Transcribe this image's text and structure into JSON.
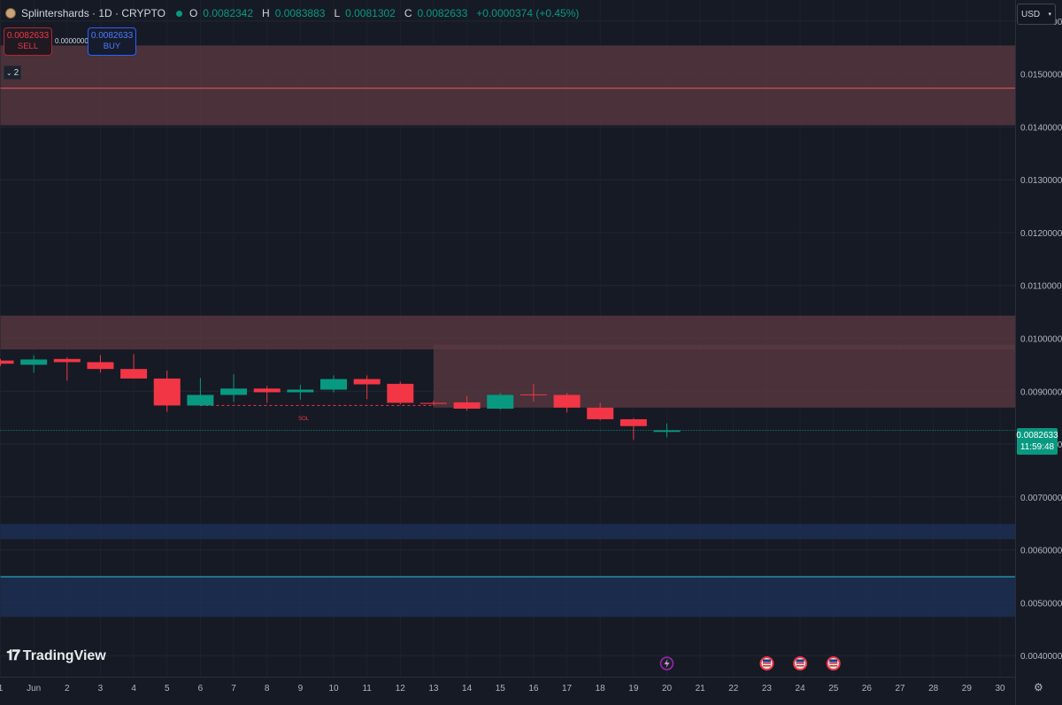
{
  "header": {
    "symbol": "Splintershards · 1D · CRYPTO",
    "open_label": "O",
    "open": "0.0082342",
    "high_label": "H",
    "high": "0.0083883",
    "low_label": "L",
    "low": "0.0081302",
    "close_label": "C",
    "close": "0.0082633",
    "change": "+0.0000374 (+0.45%)"
  },
  "trade": {
    "sell_price": "0.0082633",
    "sell_label": "SELL",
    "spread": "0.0000000",
    "buy_price": "0.0082633",
    "buy_label": "BUY"
  },
  "indicators_badge": "2",
  "currency": "USD",
  "last_price": {
    "value": "0.0082633",
    "countdown": "11:59:48"
  },
  "brand": "TradingView",
  "colors": {
    "up": "#089981",
    "down": "#f23645",
    "supply_zone": "#5c3a42",
    "demand_zone": "#1e3159",
    "background": "#161a25"
  },
  "chart_data": {
    "type": "candlestick",
    "y_axis": {
      "ylim": [
        0.0036,
        0.0164
      ],
      "ticks": [
        0.016,
        0.015,
        0.014,
        0.013,
        0.012,
        0.011,
        0.01,
        0.009,
        0.008,
        0.007,
        0.006,
        0.005,
        0.004
      ],
      "tick_labels": [
        "0.0160000",
        "0.0150000",
        "0.0140000",
        "0.0130000",
        "0.0120000",
        "0.0110000",
        "0.0100000",
        "0.0090000",
        "0.0080000",
        "0.0070000",
        "0.0060000",
        "0.0050000",
        "0.0040000"
      ]
    },
    "x_axis": {
      "xlim": [
        0,
        31
      ],
      "ticks": [
        0,
        1,
        2,
        3,
        4,
        5,
        6,
        7,
        8,
        9,
        10,
        11,
        12,
        13,
        14,
        15,
        16,
        17,
        18,
        19,
        20,
        21,
        22,
        23,
        24,
        25,
        26,
        27,
        28,
        29,
        30
      ],
      "tick_labels": [
        "1",
        "Jun",
        "2",
        "3",
        "4",
        "5",
        "6",
        "7",
        "8",
        "9",
        "10",
        "11",
        "12",
        "13",
        "14",
        "15",
        "16",
        "17",
        "18",
        "19",
        "20",
        "21",
        "22",
        "23",
        "24",
        "25",
        "26",
        "27",
        "28",
        "29",
        "30"
      ]
    },
    "candles": [
      {
        "x": 0,
        "o": 0.00958,
        "h": 0.00961,
        "l": 0.00948,
        "c": 0.00952
      },
      {
        "x": 1,
        "o": 0.0095,
        "h": 0.00968,
        "l": 0.00935,
        "c": 0.0096
      },
      {
        "x": 2,
        "o": 0.00961,
        "h": 0.00964,
        "l": 0.0092,
        "c": 0.00955
      },
      {
        "x": 3,
        "o": 0.00955,
        "h": 0.00968,
        "l": 0.00935,
        "c": 0.00942
      },
      {
        "x": 4,
        "o": 0.00942,
        "h": 0.0097,
        "l": 0.00924,
        "c": 0.00924
      },
      {
        "x": 5,
        "o": 0.00924,
        "h": 0.00939,
        "l": 0.00861,
        "c": 0.00873
      },
      {
        "x": 6,
        "o": 0.00873,
        "h": 0.00925,
        "l": 0.00872,
        "c": 0.00893
      },
      {
        "x": 7,
        "o": 0.00893,
        "h": 0.00932,
        "l": 0.0088,
        "c": 0.00905
      },
      {
        "x": 8,
        "o": 0.00905,
        "h": 0.0091,
        "l": 0.00878,
        "c": 0.00898
      },
      {
        "x": 9,
        "o": 0.00898,
        "h": 0.00912,
        "l": 0.00884,
        "c": 0.00903
      },
      {
        "x": 10,
        "o": 0.00903,
        "h": 0.0093,
        "l": 0.00898,
        "c": 0.00923
      },
      {
        "x": 11,
        "o": 0.00923,
        "h": 0.0093,
        "l": 0.00885,
        "c": 0.00913
      },
      {
        "x": 12,
        "o": 0.00914,
        "h": 0.00918,
        "l": 0.00875,
        "c": 0.00878
      },
      {
        "x": 13,
        "o": 0.00878,
        "h": 0.00882,
        "l": 0.00872,
        "c": 0.00876
      },
      {
        "x": 14,
        "o": 0.00879,
        "h": 0.00891,
        "l": 0.00863,
        "c": 0.00867
      },
      {
        "x": 15,
        "o": 0.00867,
        "h": 0.00897,
        "l": 0.00865,
        "c": 0.00893
      },
      {
        "x": 16,
        "o": 0.00894,
        "h": 0.00914,
        "l": 0.0088,
        "c": 0.00893
      },
      {
        "x": 17,
        "o": 0.00893,
        "h": 0.00897,
        "l": 0.0086,
        "c": 0.00869
      },
      {
        "x": 18,
        "o": 0.00869,
        "h": 0.00878,
        "l": 0.00845,
        "c": 0.00847
      },
      {
        "x": 19,
        "o": 0.00847,
        "h": 0.00849,
        "l": 0.00808,
        "c": 0.00834
      },
      {
        "x": 20,
        "o": 0.00823,
        "h": 0.00839,
        "l": 0.00813,
        "c": 0.00826
      }
    ],
    "zones": [
      {
        "kind": "supply",
        "from_x": 0,
        "to_x": 31,
        "y_low": 0.01403,
        "y_high": 0.01554
      },
      {
        "kind": "supply",
        "from_x": 0,
        "to_x": 31,
        "y_low": 0.00979,
        "y_high": 0.01043
      },
      {
        "kind": "supply",
        "from_x": 13,
        "to_x": 31,
        "y_low": 0.00869,
        "y_high": 0.00988
      },
      {
        "kind": "demand",
        "from_x": 0,
        "to_x": 31,
        "y_low": 0.0062,
        "y_high": 0.00649
      },
      {
        "kind": "demand",
        "from_x": 0,
        "to_x": 31,
        "y_low": 0.00473,
        "y_high": 0.00549
      }
    ],
    "levels": [
      {
        "y": 0.01473,
        "color": "#f05a5a",
        "style": "solid",
        "from_x": 0,
        "to_x": 31
      },
      {
        "y": 0.00549,
        "color": "#26c6da",
        "style": "solid",
        "from_x": 0,
        "to_x": 31
      },
      {
        "y": 0.00826,
        "color": "#089981",
        "style": "dotted",
        "from_x": 0,
        "to_x": 31,
        "note": "last price line"
      },
      {
        "y": 0.00873,
        "color": "#f23645",
        "style": "dashed",
        "from_x": 6,
        "to_x": 13
      }
    ],
    "annotations": [
      {
        "text": "SOL",
        "x": 9.1,
        "y": 0.00845,
        "color": "#f23645"
      }
    ],
    "event_markers": [
      {
        "x": 20,
        "icon": "lightning-icon"
      },
      {
        "x": 23,
        "icon": "us-flag-icon"
      },
      {
        "x": 24,
        "icon": "us-flag-icon"
      },
      {
        "x": 25,
        "icon": "us-flag-icon"
      }
    ]
  }
}
